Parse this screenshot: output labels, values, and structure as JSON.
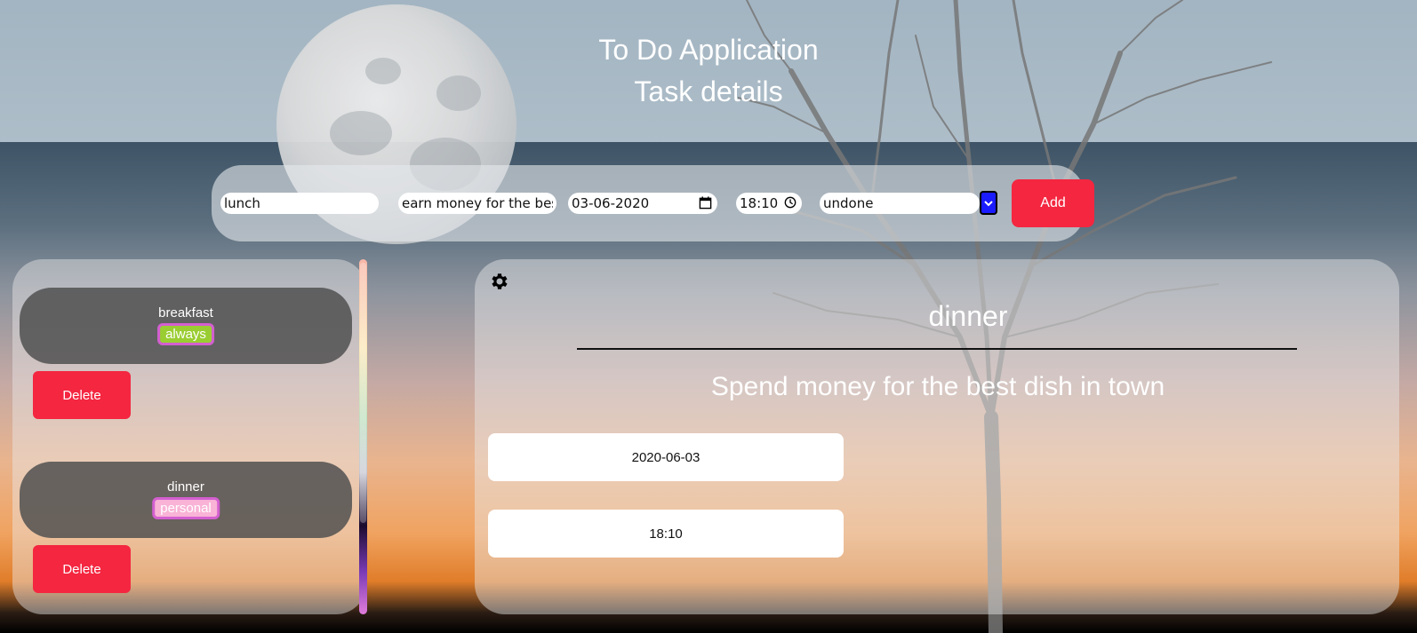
{
  "header": {
    "app_title": "To Do Application",
    "page_title": "Task details"
  },
  "form": {
    "name_value": "lunch",
    "description_value": "earn money for the best",
    "date_value": "03-06-2020",
    "time_value": "18:10",
    "status_value": "undone",
    "add_label": "Add"
  },
  "task_list": {
    "items": [
      {
        "name": "breakfast",
        "tag": "always",
        "tag_color": "#9acd32",
        "delete_label": "Delete"
      },
      {
        "name": "dinner",
        "tag": "personal",
        "tag_color": "#f9b3d6",
        "delete_label": "Delete"
      }
    ]
  },
  "detail": {
    "icon": "gear-icon",
    "title": "dinner",
    "description": "Spend money for the best dish in town",
    "date": "2020-06-03",
    "time": "18:10"
  },
  "colors": {
    "accent_red": "#f42640",
    "select_arrow_blue": "#1b1bff"
  }
}
